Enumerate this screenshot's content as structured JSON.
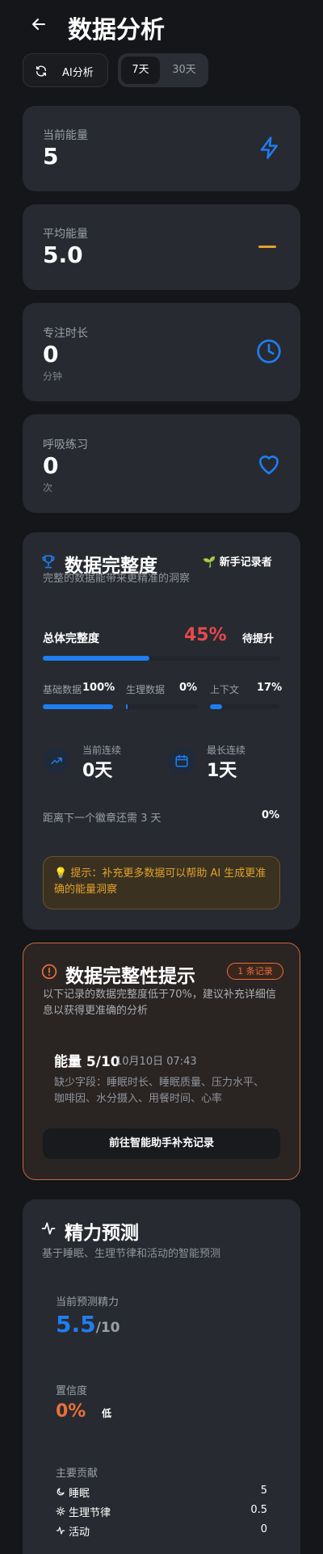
{
  "header": {
    "title": "数据分析"
  },
  "toolbar": {
    "ai_label": "AI分析",
    "range_options": [
      "7天",
      "30天"
    ],
    "range_selected": "7天"
  },
  "stats": [
    {
      "label": "当前能量",
      "value": "5",
      "unit": "",
      "icon": "lightning-icon"
    },
    {
      "label": "平均能量",
      "value": "5.0",
      "unit": "",
      "icon": "dash-icon"
    },
    {
      "label": "专注时长",
      "value": "0",
      "unit": "分钟",
      "icon": "clock-icon"
    },
    {
      "label": "呼吸练习",
      "value": "0",
      "unit": "次",
      "icon": "heart-icon"
    }
  ],
  "completeness": {
    "title": "数据完整度",
    "subtitle": "完整的数据能带来更精准的洞察",
    "badge": "🌱 新手记录者",
    "overall_label": "总体完整度",
    "overall_value": "45%",
    "overall_fraction": 0.45,
    "overall_status": "待提升",
    "sub": [
      {
        "label": "基础数据",
        "value": "100%",
        "fraction": 1.0
      },
      {
        "label": "生理数据",
        "value": "0%",
        "fraction": 0.0
      },
      {
        "label": "上下文",
        "value": "17%",
        "fraction": 0.17
      }
    ],
    "streak_current_label": "当前连续",
    "streak_current_value": "0天",
    "streak_longest_label": "最长连续",
    "streak_longest_value": "1天",
    "next_badge_text": "距离下一个徽章还需 3 天",
    "next_badge_value": "0%",
    "tip": "💡 提示：补充更多数据可以帮助 AI 生成更准确的能量洞察"
  },
  "hint": {
    "title": "数据完整性提示",
    "count_badge": "1 条记录",
    "description": "以下记录的数据完整度低于70%，建议补充详细信息以获得更准确的分析",
    "record_energy": "能量 5/10",
    "record_time": "10月10日 07:43",
    "missing": "缺少字段：睡眠时长、睡眠质量、压力水平、咖啡因、水分摄入、用餐时间、心率",
    "action_label": "前往智能助手补充记录"
  },
  "prediction": {
    "title": "精力预测",
    "subtitle": "基于睡眠、生理节律和活动的智能预测",
    "current_label": "当前预测精力",
    "current_value": "5.5",
    "current_max": "/10",
    "confidence_label": "置信度",
    "confidence_value": "0%",
    "confidence_level": "低",
    "contrib_title": "主要贡献",
    "contributions": [
      {
        "icon": "moon-icon",
        "label": "睡眠",
        "value": "5"
      },
      {
        "icon": "sun-icon",
        "label": "生理节律",
        "value": "0.5"
      },
      {
        "icon": "activity-icon",
        "label": "活动",
        "value": "0"
      }
    ]
  },
  "colors": {
    "accent": "#1e7ef2",
    "danger": "#e5484d",
    "warning": "#e0a22b",
    "orange": "#e8703a"
  }
}
